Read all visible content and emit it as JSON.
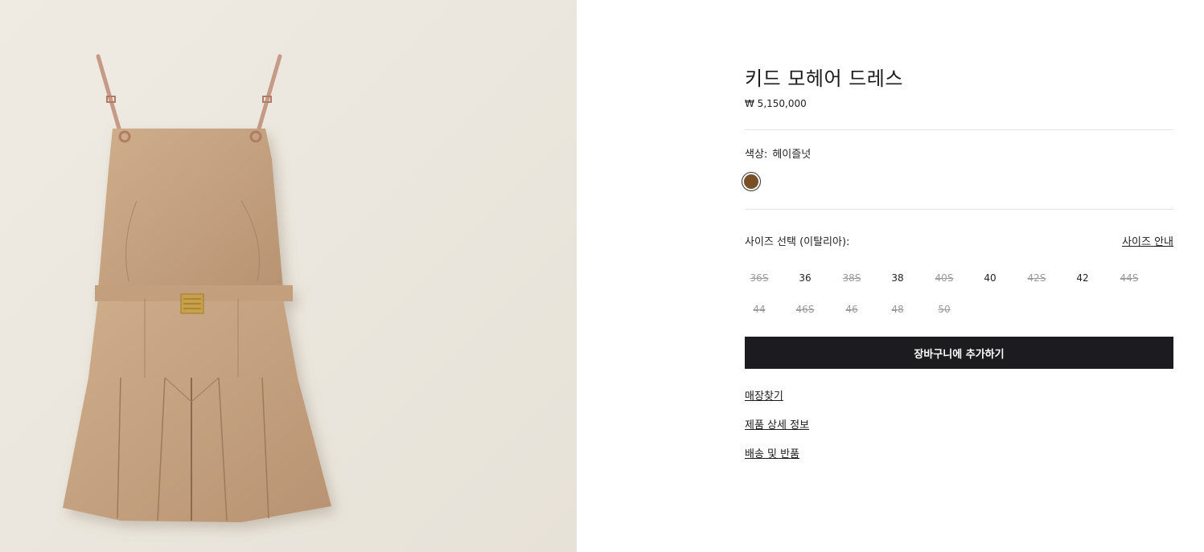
{
  "product": {
    "title": "키드 모헤어 드레스",
    "price": "₩ 5,150,000",
    "image_alt": "product-photo-dress"
  },
  "color": {
    "label": "색상:",
    "value": "헤이즐넛",
    "swatch_hex": "#7a4f25"
  },
  "size": {
    "label": "사이즈 선택 (이탈리아):",
    "guide_label": "사이즈 안내",
    "options": [
      {
        "label": "36S",
        "available": false
      },
      {
        "label": "36",
        "available": true
      },
      {
        "label": "38S",
        "available": false
      },
      {
        "label": "38",
        "available": true
      },
      {
        "label": "40S",
        "available": false
      },
      {
        "label": "40",
        "available": true
      },
      {
        "label": "42S",
        "available": false
      },
      {
        "label": "42",
        "available": true
      },
      {
        "label": "44S",
        "available": false
      },
      {
        "label": "44",
        "available": false
      },
      {
        "label": "46S",
        "available": false
      },
      {
        "label": "46",
        "available": false
      },
      {
        "label": "48",
        "available": false
      },
      {
        "label": "50",
        "available": false
      }
    ]
  },
  "actions": {
    "add_to_cart": "장바구니에 추가하기"
  },
  "links": {
    "store_finder": "매장찾기",
    "product_details": "제품 상세 정보",
    "shipping_returns": "배송 및 반품"
  },
  "colors": {
    "button_bg": "#1c1c1e",
    "background_image": "#ebe6dd",
    "fabric": "#c7a583"
  }
}
